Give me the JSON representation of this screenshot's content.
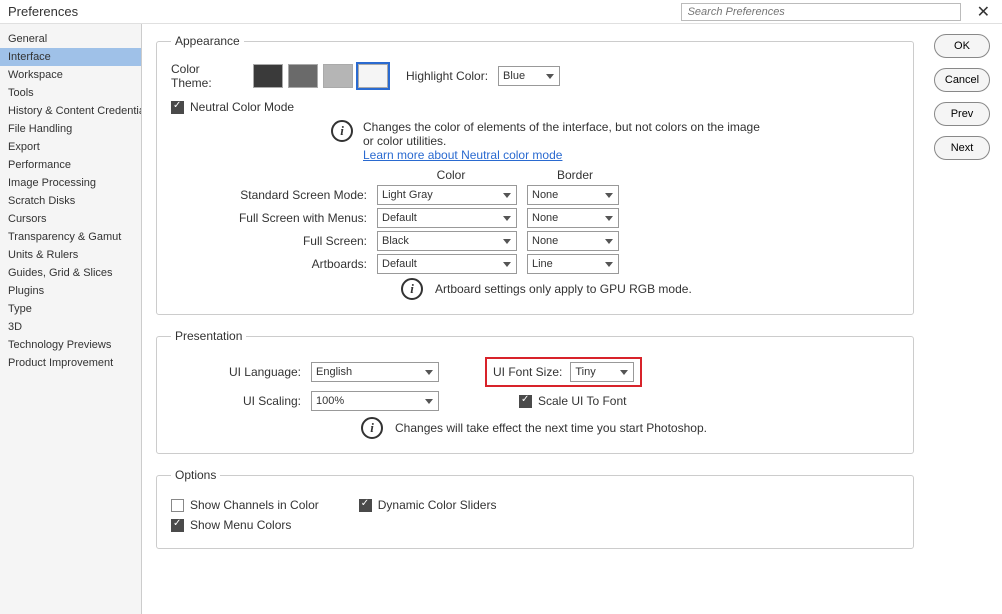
{
  "window": {
    "title": "Preferences",
    "search_placeholder": "Search Preferences"
  },
  "sidebar": {
    "items": [
      "General",
      "Interface",
      "Workspace",
      "Tools",
      "History & Content Credentials",
      "File Handling",
      "Export",
      "Performance",
      "Image Processing",
      "Scratch Disks",
      "Cursors",
      "Transparency & Gamut",
      "Units & Rulers",
      "Guides, Grid & Slices",
      "Plugins",
      "Type",
      "3D",
      "Technology Previews",
      "Product Improvement"
    ],
    "active_index": 1
  },
  "buttons": {
    "ok": "OK",
    "cancel": "Cancel",
    "prev": "Prev",
    "next": "Next"
  },
  "appearance": {
    "legend": "Appearance",
    "color_theme_label": "Color Theme:",
    "swatches": [
      "#3a3a3a",
      "#6a6a6a",
      "#b5b5b5",
      "#f5f5f5"
    ],
    "selected_swatch": 3,
    "highlight_label": "Highlight Color:",
    "highlight_value": "Blue",
    "neutral_label": "Neutral Color Mode",
    "neutral_desc": "Changes the color of elements of the interface, but not colors on the image or color utilities.",
    "neutral_link": "Learn more about Neutral color mode",
    "col_color": "Color",
    "col_border": "Border",
    "modes": [
      {
        "label": "Standard Screen Mode:",
        "color": "Light Gray",
        "border": "None"
      },
      {
        "label": "Full Screen with Menus:",
        "color": "Default",
        "border": "None"
      },
      {
        "label": "Full Screen:",
        "color": "Black",
        "border": "None"
      },
      {
        "label": "Artboards:",
        "color": "Default",
        "border": "Line"
      }
    ],
    "artboard_note": "Artboard settings only apply to GPU RGB mode."
  },
  "presentation": {
    "legend": "Presentation",
    "ui_language_label": "UI Language:",
    "ui_language_value": "English",
    "ui_font_label": "UI Font Size:",
    "ui_font_value": "Tiny",
    "ui_scaling_label": "UI Scaling:",
    "ui_scaling_value": "100%",
    "scale_to_font_label": "Scale UI To Font",
    "restart_note": "Changes will take effect the next time you start Photoshop."
  },
  "options": {
    "legend": "Options",
    "channels_label": "Show Channels in Color",
    "channels_checked": false,
    "dynamic_label": "Dynamic Color Sliders",
    "dynamic_checked": true,
    "menu_label": "Show Menu Colors",
    "menu_checked": true
  }
}
